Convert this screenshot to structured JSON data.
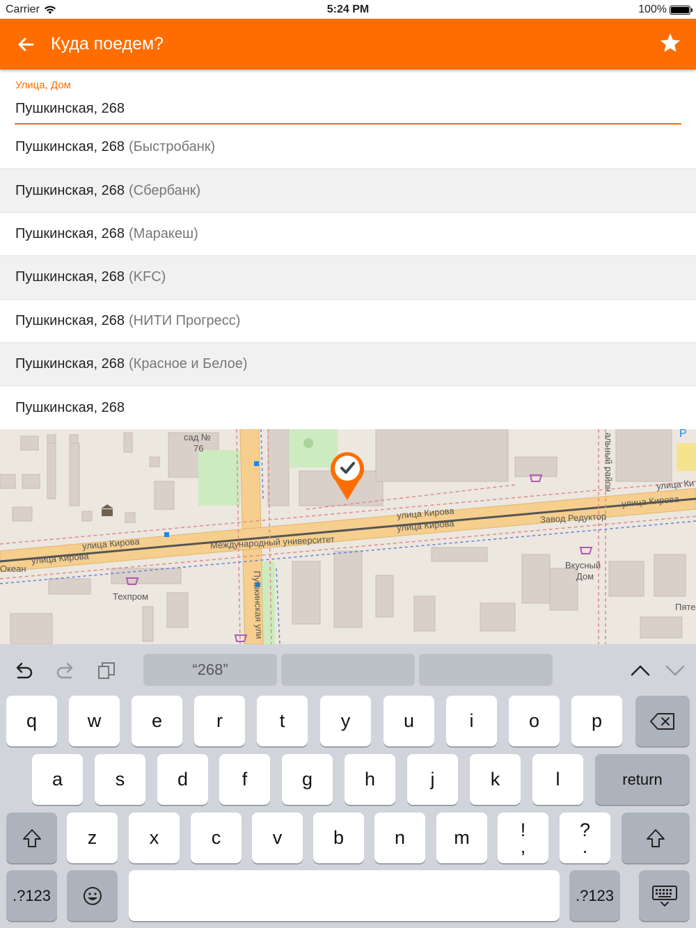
{
  "status_bar": {
    "carrier": "Carrier",
    "time": "5:24 PM",
    "battery": "100%",
    "battery_level": 1.0
  },
  "app_bar": {
    "title": "Куда поедем?",
    "back_icon": "arrow-left-icon",
    "favorite_icon": "star-icon"
  },
  "address_input": {
    "label": "Улица, Дом",
    "value": "Пушкинская, 268"
  },
  "suggestions": [
    {
      "main": "Пушкинская, 268",
      "extra": "(Быстробанк)"
    },
    {
      "main": "Пушкинская, 268",
      "extra": "(Сбербанк)"
    },
    {
      "main": "Пушкинская, 268",
      "extra": "(Маракеш)"
    },
    {
      "main": "Пушкинская, 268",
      "extra": "(KFC)"
    },
    {
      "main": "Пушкинская, 268",
      "extra": "(НИТИ Прогресс)"
    },
    {
      "main": "Пушкинская, 268",
      "extra": "(Красное и Белое)"
    },
    {
      "main": "Пушкинская, 268",
      "extra": ""
    }
  ],
  "map": {
    "labels": {
      "kirova_1": "улица Кирова",
      "kirova_2": "улица Кирова",
      "kirova_3": "улица Кирова",
      "kirova_4": "улица Кирова",
      "kirova_5": "улица Кирова",
      "kirova_6": "улица Ки",
      "university": "Международный университет",
      "reduktor": "Завод Редуктор",
      "tekhprom": "Техпром",
      "okean": "Океан",
      "vkusny_1": "Вкусный",
      "vkusny_2": "Дом",
      "pushkinskaya": "Пушкинская ули",
      "garden_1": "сад №",
      "garden_2": "76",
      "district": "альный район",
      "pyate": "Пяте",
      "parking": "P"
    },
    "pin_icon": "location-pin-check-icon"
  },
  "keyboard": {
    "toolbar": {
      "undo_icon": "undo-icon",
      "redo_icon": "redo-icon",
      "paste_icon": "clipboard-icon",
      "prediction": "“268”",
      "up_icon": "chevron-up-icon",
      "down_icon": "chevron-down-icon"
    },
    "row1": [
      "q",
      "w",
      "e",
      "r",
      "t",
      "y",
      "u",
      "i",
      "o",
      "p"
    ],
    "row2": [
      "a",
      "s",
      "d",
      "f",
      "g",
      "h",
      "j",
      "k",
      "l"
    ],
    "row3": [
      "z",
      "x",
      "c",
      "v",
      "b",
      "n",
      "m"
    ],
    "punct1": [
      "!",
      ","
    ],
    "punct2": [
      "?",
      "."
    ],
    "return": "return",
    "numbers": ".?123",
    "backspace_icon": "backspace-icon",
    "shift_icon": "shift-icon",
    "emoji_icon": "emoji-icon",
    "hide_icon": "keyboard-hide-icon"
  }
}
